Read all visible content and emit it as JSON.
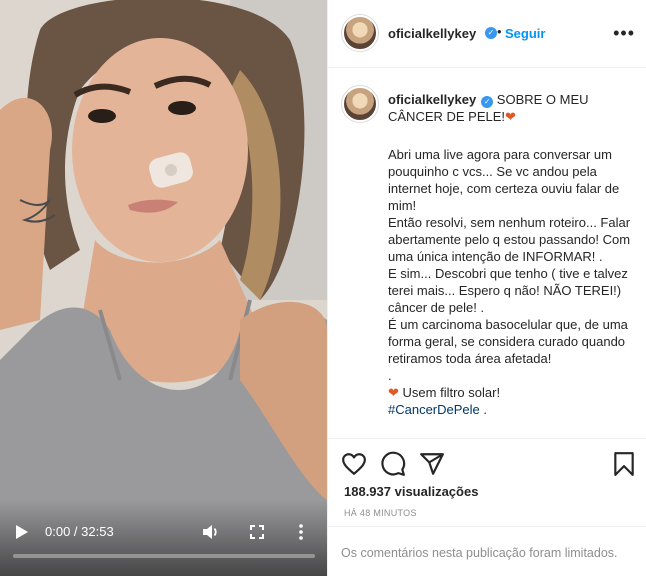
{
  "video": {
    "time_display": "0:00 / 32:53",
    "progress": 0.0,
    "icons": {
      "play": "play-icon",
      "volume": "volume-icon",
      "fullscreen": "fullscreen-icon",
      "more": "more-vertical-icon"
    }
  },
  "header": {
    "username": "oficialkellykey",
    "dot": "•",
    "follow_label": "Seguir",
    "more_label": "•••"
  },
  "caption": {
    "username": "oficialkellykey",
    "title": "SOBRE O MEU CÂNCER DE PELE!",
    "heart": "❤",
    "body": "Abri uma live agora para conversar um pouquinho c vcs... Se vc andou pela internet hoje, com certeza ouviu falar de mim!\nEntão resolvi, sem nenhum roteiro... Falar abertamente pelo q estou passando! Com uma única intenção de INFORMAR! .\nE sim... Descobri que tenho ( tive e talvez terei mais... Espero q não! NÃO TEREI!) câncer de pele! .\nÉ um carcinoma basocelular que, de uma forma geral, se considera curado quando retiramos toda área afetada!\n.",
    "tip": "Usem filtro solar!",
    "hashtag": "#CancerDePele",
    "hashtag_suffix": " ."
  },
  "stats": {
    "views": "188.937 visualizações",
    "posted_ago": "HÁ 48 MINUTOS"
  },
  "comments_notice": "Os comentários nesta publicação foram limitados.",
  "colors": {
    "accent": "#0095f6",
    "verified": "#3897f0",
    "heart": "#e25822",
    "hashtag": "#00376b",
    "muted": "#8e8e8e"
  }
}
